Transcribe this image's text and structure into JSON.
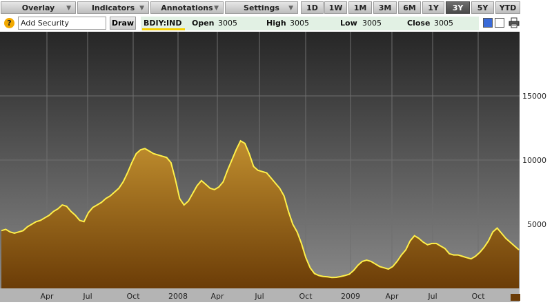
{
  "toolbar": {
    "menus": [
      {
        "label": "Overlay"
      },
      {
        "label": "Indicators"
      },
      {
        "label": "Annotations"
      },
      {
        "label": "Settings"
      }
    ],
    "ranges": [
      "1D",
      "1W",
      "1M",
      "3M",
      "6M",
      "1Y",
      "3Y",
      "5Y",
      "YTD"
    ],
    "active_range": "3Y"
  },
  "security": {
    "placeholder": "Add Security",
    "draw_label": "Draw"
  },
  "quote": {
    "ticker": "BDIY:IND",
    "open_label": "Open",
    "open": "3005",
    "high_label": "High",
    "high": "3005",
    "low_label": "Low",
    "low": "3005",
    "close_label": "Close",
    "close": "3005"
  },
  "colors": {
    "chart_bg_top": "#262626",
    "chart_bg_bottom": "#8a8a8a",
    "line": "#fff04a",
    "fill_top": "#c08e2e",
    "fill_bottom": "#6b3c07",
    "swatch_blue": "#3a6ad8"
  },
  "chart_data": {
    "type": "area",
    "title": "",
    "xlabel": "",
    "ylabel": "",
    "ylim": [
      0,
      20000
    ],
    "y_ticks": [
      5000,
      10000,
      15000
    ],
    "x_ticks": [
      "Apr",
      "Jul",
      "Oct",
      "2008",
      "Apr",
      "Jul",
      "Oct",
      "2009",
      "Apr",
      "Jul",
      "Oct"
    ],
    "grid": true,
    "series": [
      {
        "values": [
          4500,
          4600,
          4400,
          4300,
          4400,
          4500,
          4800,
          5000,
          5200,
          5300,
          5500,
          5700,
          6000,
          6200,
          6500,
          6400,
          6000,
          5700,
          5300,
          5200,
          5900,
          6300,
          6500,
          6700,
          7000,
          7200,
          7500,
          7800,
          8300,
          9000,
          9800,
          10500,
          10800,
          10900,
          10700,
          10500,
          10400,
          10300,
          10200,
          9800,
          8500,
          7000,
          6500,
          6800,
          7400,
          8000,
          8400,
          8100,
          7800,
          7700,
          7900,
          8300,
          9200,
          10000,
          10800,
          11500,
          11300,
          10500,
          9500,
          9200,
          9100,
          9000,
          8600,
          8200,
          7800,
          7200,
          6000,
          5000,
          4400,
          3500,
          2400,
          1600,
          1150,
          1000,
          930,
          900,
          850,
          860,
          920,
          1000,
          1100,
          1400,
          1800,
          2100,
          2200,
          2100,
          1900,
          1700,
          1600,
          1500,
          1700,
          2100,
          2600,
          3000,
          3700,
          4100,
          3900,
          3600,
          3400,
          3500,
          3500,
          3300,
          3100,
          2700,
          2600,
          2600,
          2500,
          2400,
          2300,
          2500,
          2800,
          3200,
          3700,
          4400,
          4700,
          4300,
          3900,
          3600,
          3300,
          3005
        ]
      }
    ]
  }
}
